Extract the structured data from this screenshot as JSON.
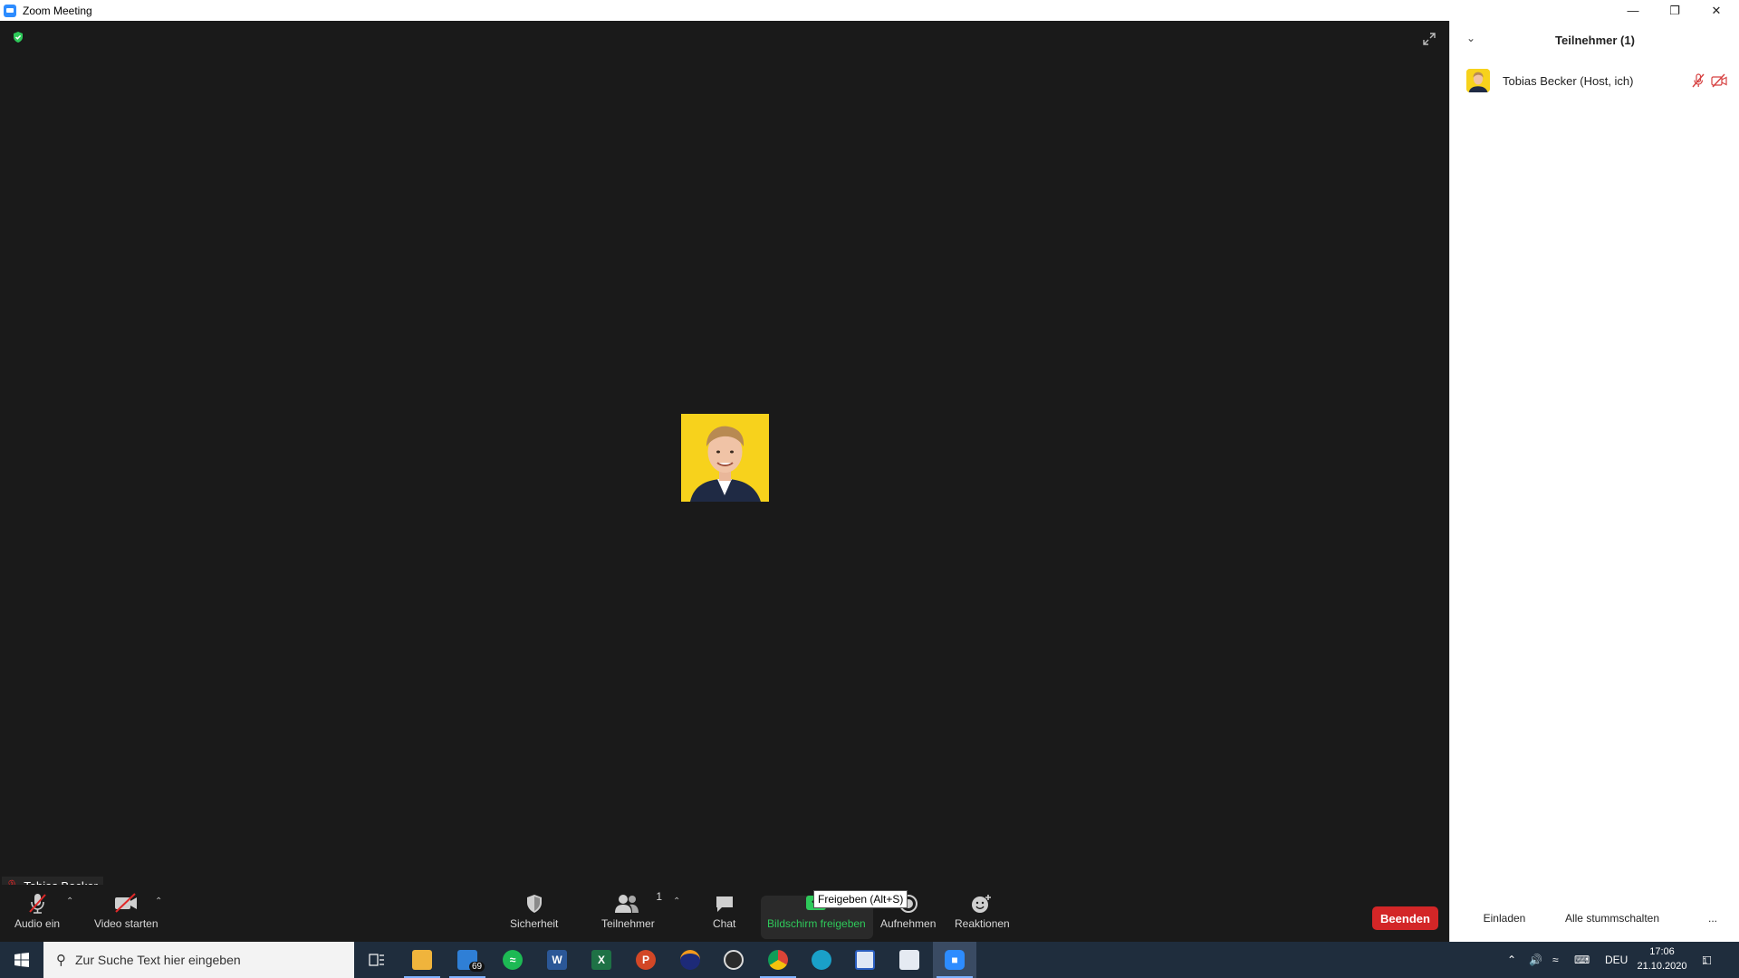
{
  "window": {
    "title": "Zoom Meeting"
  },
  "video": {
    "participant_name": "Tobias Becker"
  },
  "toolbar": {
    "audio_label": "Audio ein",
    "video_label": "Video starten",
    "security_label": "Sicherheit",
    "participants_label": "Teilnehmer",
    "participants_count": "1",
    "chat_label": "Chat",
    "share_label": "Bildschirm freigeben",
    "share_tooltip": "Freigeben (Alt+S)",
    "record_label": "Aufnehmen",
    "reactions_label": "Reaktionen",
    "end_label": "Beenden"
  },
  "panel": {
    "title": "Teilnehmer (1)",
    "participants": [
      {
        "name": "Tobias Becker (Host, ich)"
      }
    ],
    "invite_label": "Einladen",
    "mute_all_label": "Alle stummschalten",
    "more_label": "..."
  },
  "taskbar": {
    "search_placeholder": "Zur Suche Text hier eingeben",
    "mail_badge": "69",
    "language": "DEU",
    "time": "17:06",
    "date": "21.10.2020",
    "notification_count": "1"
  },
  "colors": {
    "accent_green": "#2ec95a",
    "end_red": "#d32627",
    "avatar_yellow": "#f7d21c",
    "taskbar": "#1f2d3d"
  }
}
